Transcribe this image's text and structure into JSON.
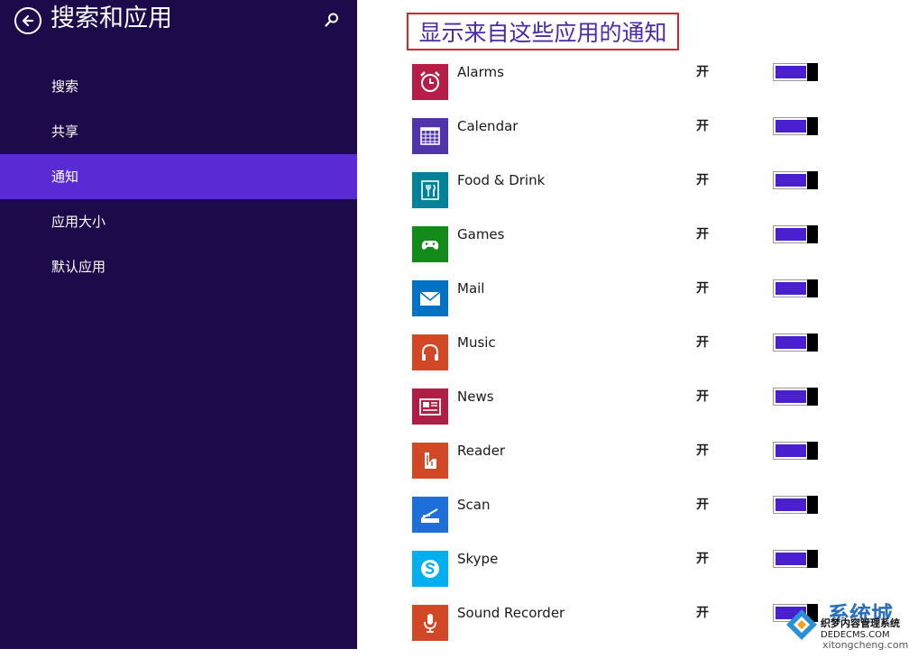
{
  "sidebar": {
    "title": "搜索和应用",
    "back_icon": "back-arrow-icon",
    "search_icon": "search-icon",
    "background": "#1c0a4a",
    "active_color": "#5a2bd4",
    "items": [
      {
        "label": "搜索",
        "active": false
      },
      {
        "label": "共享",
        "active": false
      },
      {
        "label": "通知",
        "active": true
      },
      {
        "label": "应用大小",
        "active": false
      },
      {
        "label": "默认应用",
        "active": false
      }
    ]
  },
  "content": {
    "title": "显示来自这些应用的通知",
    "toggle_on_color": "#4a1fd0",
    "apps": [
      {
        "name": "Alarms",
        "state": "开",
        "on": true,
        "icon": "alarm-clock-icon",
        "color": "#b61d47"
      },
      {
        "name": "Calendar",
        "state": "开",
        "on": true,
        "icon": "calendar-grid-icon",
        "color": "#5133ab"
      },
      {
        "name": "Food & Drink",
        "state": "开",
        "on": true,
        "icon": "fork-knife-icon",
        "color": "#008299"
      },
      {
        "name": "Games",
        "state": "开",
        "on": true,
        "icon": "game-controller-icon",
        "color": "#128b1b"
      },
      {
        "name": "Mail",
        "state": "开",
        "on": true,
        "icon": "envelope-icon",
        "color": "#0072c6"
      },
      {
        "name": "Music",
        "state": "开",
        "on": true,
        "icon": "headphones-icon",
        "color": "#d24726"
      },
      {
        "name": "News",
        "state": "开",
        "on": true,
        "icon": "newspaper-icon",
        "color": "#b01e45"
      },
      {
        "name": "Reader",
        "state": "开",
        "on": true,
        "icon": "reader-book-icon",
        "color": "#d24726"
      },
      {
        "name": "Scan",
        "state": "开",
        "on": true,
        "icon": "scanner-icon",
        "color": "#1e6fd9"
      },
      {
        "name": "Skype",
        "state": "开",
        "on": true,
        "icon": "skype-icon",
        "color": "#00aff0"
      },
      {
        "name": "Sound Recorder",
        "state": "开",
        "on": true,
        "icon": "microphone-icon",
        "color": "#d24726"
      }
    ]
  },
  "watermark": {
    "main": "系统城",
    "sub": "织梦内容管理系统",
    "domain": "DEDECMS.COM",
    "url": "xitongcheng.com"
  }
}
